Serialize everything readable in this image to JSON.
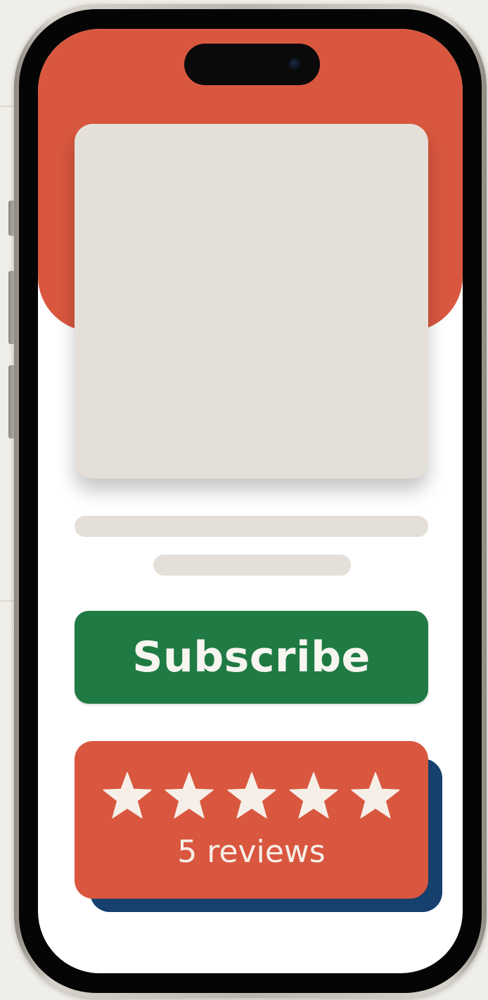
{
  "colors": {
    "header_accent": "#d9573f",
    "subscribe_green": "#1f7a44",
    "review_shadow_navy": "#16406e",
    "placeholder_gray": "#e4e0d9",
    "star_fill": "#f6efe8"
  },
  "phone": {
    "icons": [
      "camera-icon"
    ]
  },
  "content": {
    "subscribe_label": "Subscribe"
  },
  "reviews": {
    "rating": 5,
    "max_rating": 5,
    "count_label": "5 reviews",
    "icon": "star-icon"
  }
}
